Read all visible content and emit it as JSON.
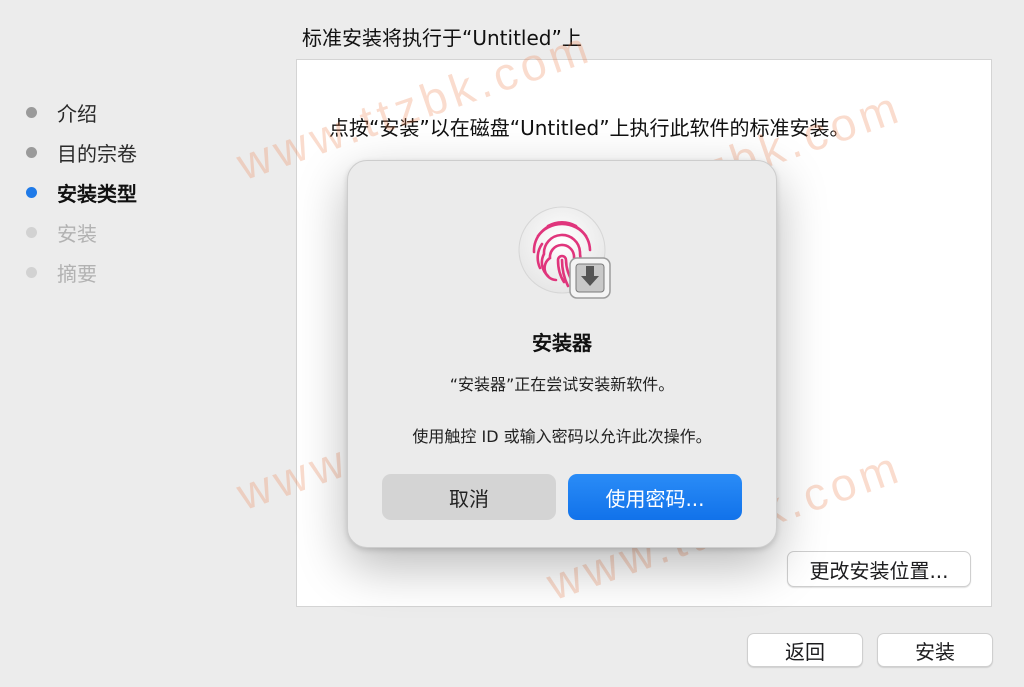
{
  "page_title": "标准安装将执行于“Untitled”上",
  "sidebar": {
    "steps": [
      {
        "label": "介绍",
        "state": "done"
      },
      {
        "label": "目的宗卷",
        "state": "done"
      },
      {
        "label": "安装类型",
        "state": "active"
      },
      {
        "label": "安装",
        "state": "future"
      },
      {
        "label": "摘要",
        "state": "future"
      }
    ]
  },
  "content": {
    "message": "点按“安装”以在磁盘“Untitled”上执行此软件的标准安装。",
    "change_location_label": "更改安装位置..."
  },
  "footer": {
    "back_label": "返回",
    "install_label": "安装"
  },
  "dialog": {
    "icon": "touch-id-installer-icon",
    "title": "安装器",
    "message": "“安装器”正在尝试安装新软件。",
    "info": "使用触控 ID 或输入密码以允许此次操作。",
    "cancel_label": "取消",
    "use_password_label": "使用密码..."
  },
  "watermark_text": "www.ttzbk.com",
  "colors": {
    "accent": "#1f7ae8",
    "fingerprint": "#e0357c",
    "watermark": "#ec7840"
  }
}
